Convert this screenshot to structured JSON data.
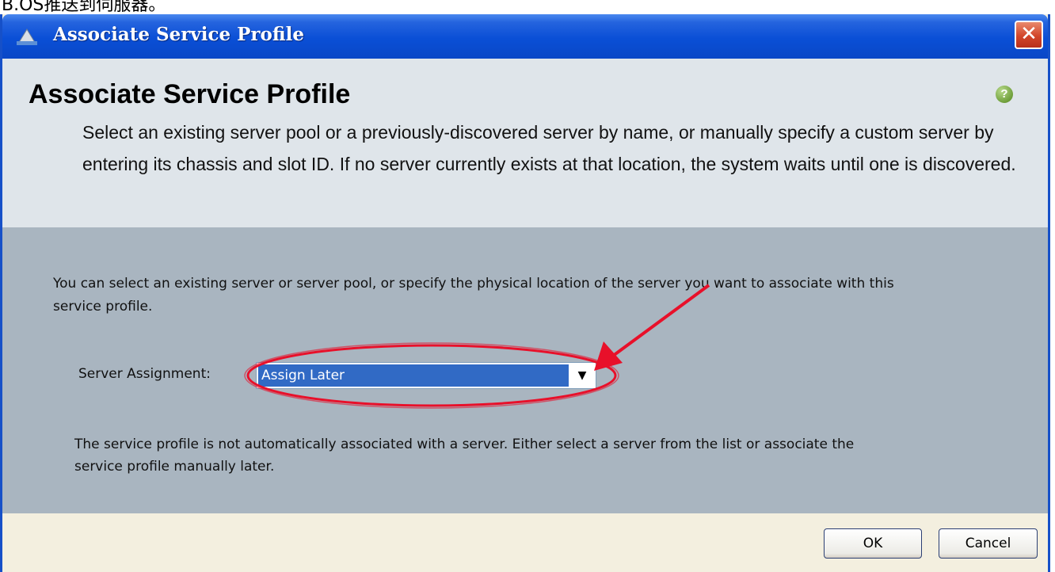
{
  "caption": "B.OS推送到伺服器。",
  "window": {
    "title": "Associate Service Profile",
    "close_glyph": "✕"
  },
  "header": {
    "title": "Associate Service Profile",
    "help_glyph": "?",
    "description": "Select an existing server pool or a previously-discovered server by name, or manually specify a custom server by entering its chassis and slot ID. If no server currently exists at that location, the system waits until one is discovered."
  },
  "main": {
    "intro": "You can select an existing server or server pool, or specify the physical location of the server you want to associate with this service profile.",
    "server_assignment_label": "Server Assignment:",
    "server_assignment_value": "Assign Later",
    "note": "The service profile is not automatically associated with a server. Either select a server from the list or associate the service profile manually later."
  },
  "footer": {
    "ok_label": "OK",
    "cancel_label": "Cancel"
  },
  "icons": {
    "title_icon": "ucs-manager-icon",
    "help_icon": "help-icon",
    "dropdown_icon": "chevron-down-icon"
  },
  "colors": {
    "titlebar": "#0a4fd6",
    "header_bg": "#dfe5ea",
    "main_bg": "#a9b5c0",
    "selection": "#316ac5",
    "annotation": "#e8102a"
  }
}
